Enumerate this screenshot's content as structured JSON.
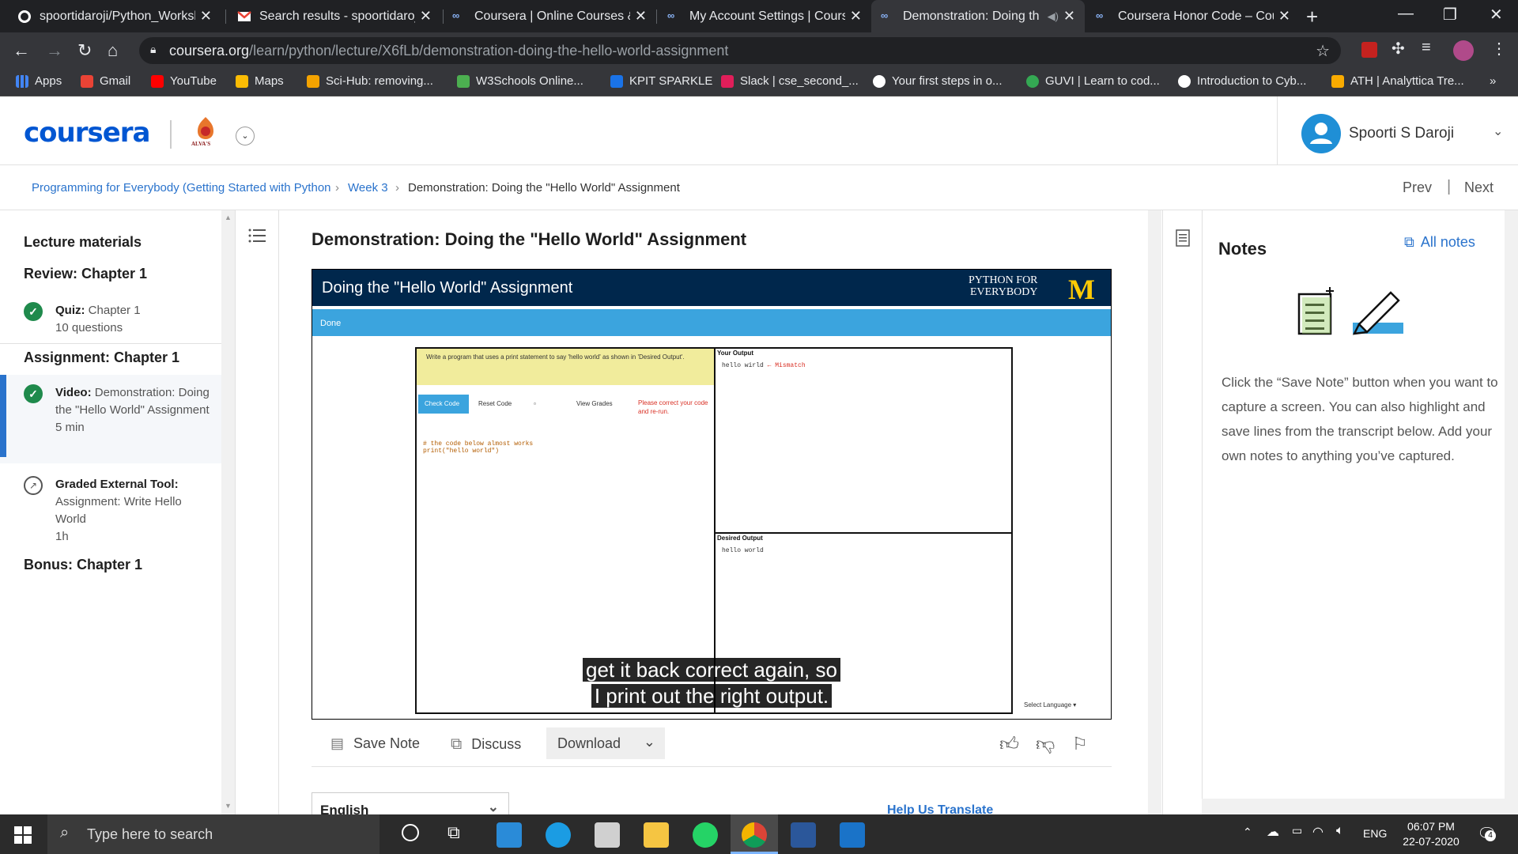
{
  "browser": {
    "tabs": [
      {
        "title": "spoortidaroji/Python_Worksh",
        "icon": "github-icon"
      },
      {
        "title": "Search results - spoortidaroji",
        "icon": "gmail-icon"
      },
      {
        "title": "Coursera | Online Courses &",
        "icon": "coursera-icon"
      },
      {
        "title": "My Account Settings | Cours",
        "icon": "coursera-icon"
      },
      {
        "title": "Demonstration: Doing th",
        "icon": "coursera-icon",
        "active": true
      },
      {
        "title": "Coursera Honor Code – Cour",
        "icon": "coursera-icon"
      }
    ],
    "url_host": "coursera.org",
    "url_path": "/learn/python/lecture/X6fLb/demonstration-doing-the-hello-world-assignment",
    "bookmarks": [
      "Apps",
      "Gmail",
      "YouTube",
      "Maps",
      "Sci-Hub: removing...",
      "W3Schools Online...",
      "KPIT SPARKLE",
      "Slack | cse_second_...",
      "Your first steps in o...",
      "GUVI | Learn to cod...",
      "Introduction to Cyb...",
      "ATH | Analyttica Tre..."
    ]
  },
  "header": {
    "logo": "coursera",
    "partner_label": "ALVA'S",
    "user_name": "Spoorti S Daroji"
  },
  "breadcrumb": {
    "course": "Programming for Everybody (Getting Started with Python",
    "week": "Week 3",
    "current": "Demonstration: Doing the \"Hello World\" Assignment",
    "prev": "Prev",
    "next": "Next"
  },
  "sidebar": {
    "heading": "Lecture materials",
    "sections": [
      {
        "title": "Review: Chapter 1"
      },
      {
        "title": "Assignment: Chapter 1"
      },
      {
        "title": "Bonus: Chapter 1"
      }
    ],
    "items": [
      {
        "type": "Quiz:",
        "name": "Chapter 1",
        "meta": "10 questions"
      },
      {
        "type": "Video:",
        "name": "Demonstration: Doing the \"Hello World\" Assignment",
        "meta": "5 min"
      },
      {
        "type": "Graded External Tool:",
        "name": "Assignment: Write Hello World",
        "meta": "1h"
      }
    ]
  },
  "main": {
    "title": "Demonstration: Doing the \"Hello World\" Assignment",
    "video": {
      "slide_title": "Doing the \"Hello World\" Assignment",
      "brand_line1": "PYTHON FOR",
      "brand_line2": "EVERYBODY",
      "brand_logo": "M",
      "done_label": "Done",
      "instructions": "Write a program that uses a print statement to say 'hello world' as shown in 'Desired Output'.",
      "check_code": "Check Code",
      "reset_code": "Reset Code",
      "view_grades": "View Grades",
      "error_msg": "Please correct your code and re-run.",
      "code_line1": "# the code below almost works",
      "code_line2": "print(\"hello world\")",
      "your_output_label": "Your Output",
      "your_output": "hello wirld",
      "mismatch": "← Mismatch",
      "desired_output_label": "Desired Output",
      "desired_output": "hello world",
      "select_language": "Select Language",
      "subtitle_line1": "get it back correct again, so",
      "subtitle_line2": "I print out the right output."
    },
    "actions": {
      "save_note": "Save Note",
      "discuss": "Discuss",
      "download": "Download"
    },
    "language": "English",
    "help_translate": "Help Us Translate"
  },
  "notes": {
    "title": "Notes",
    "all_notes": "All notes",
    "body": "Click the “Save Note” button when you want to capture a screen. You can also highlight and save lines from the transcript below. Add your own notes to anything you’ve captured."
  },
  "taskbar": {
    "search_placeholder": "Type here to search",
    "lang": "ENG",
    "time": "06:07 PM",
    "date": "22-07-2020",
    "notif_count": "4"
  }
}
